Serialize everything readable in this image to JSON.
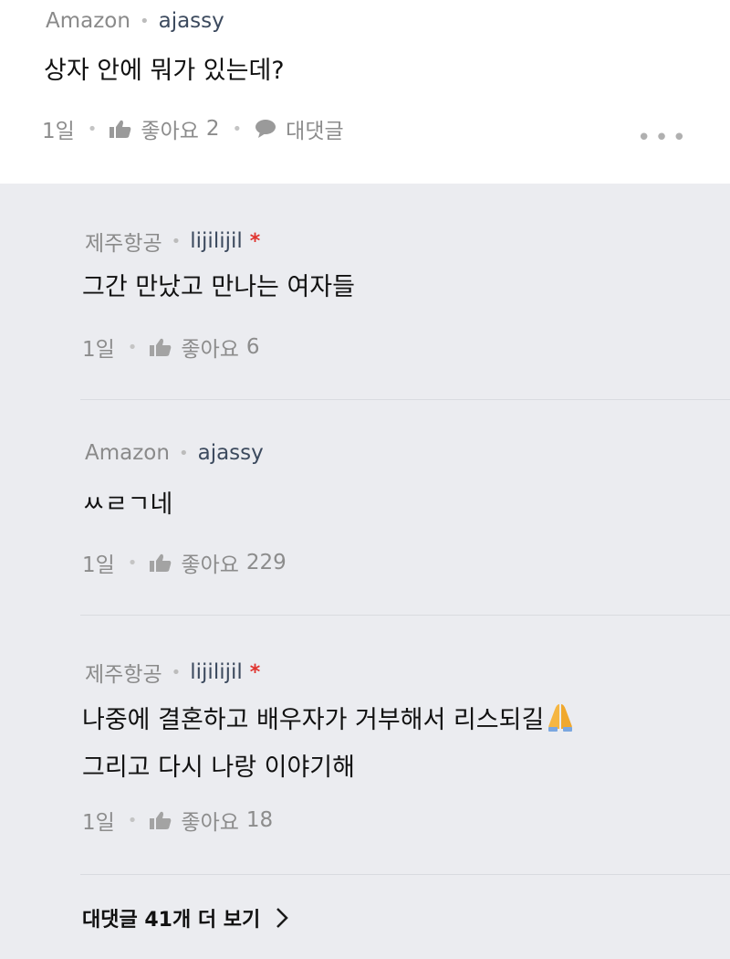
{
  "post": {
    "company": "Amazon",
    "author": "ajassy",
    "text": "상자 안에 뭐가 있는데?",
    "time": "1일",
    "like_label": "좋아요",
    "like_count": "2",
    "reply_label": "대댓글",
    "more": "•••"
  },
  "replies": [
    {
      "company": "제주항공",
      "author": "lijilijil",
      "badge": "*",
      "lines": [
        "그간 만났고 만나는 여자들"
      ],
      "time": "1일",
      "like_label": "좋아요",
      "like_count": "6"
    },
    {
      "company": "Amazon",
      "author": "ajassy",
      "lines": [
        "ㅆㄹㄱ네"
      ],
      "time": "1일",
      "like_label": "좋아요",
      "like_count": "229"
    },
    {
      "company": "제주항공",
      "author": "lijilijil",
      "badge": "*",
      "lines": [
        "나중에 결혼하고 배우자가 거부해서 리스되길",
        "그리고 다시 나랑 이야기해"
      ],
      "emoji": "folded-hands-emoji",
      "time": "1일",
      "like_label": "좋아요",
      "like_count": "18"
    }
  ],
  "more_replies": {
    "label": "대댓글 41개 더 보기"
  },
  "colors": {
    "reply_bg": "#ebecf0",
    "badge": "#e0342f",
    "author": "#3c4a5e"
  }
}
